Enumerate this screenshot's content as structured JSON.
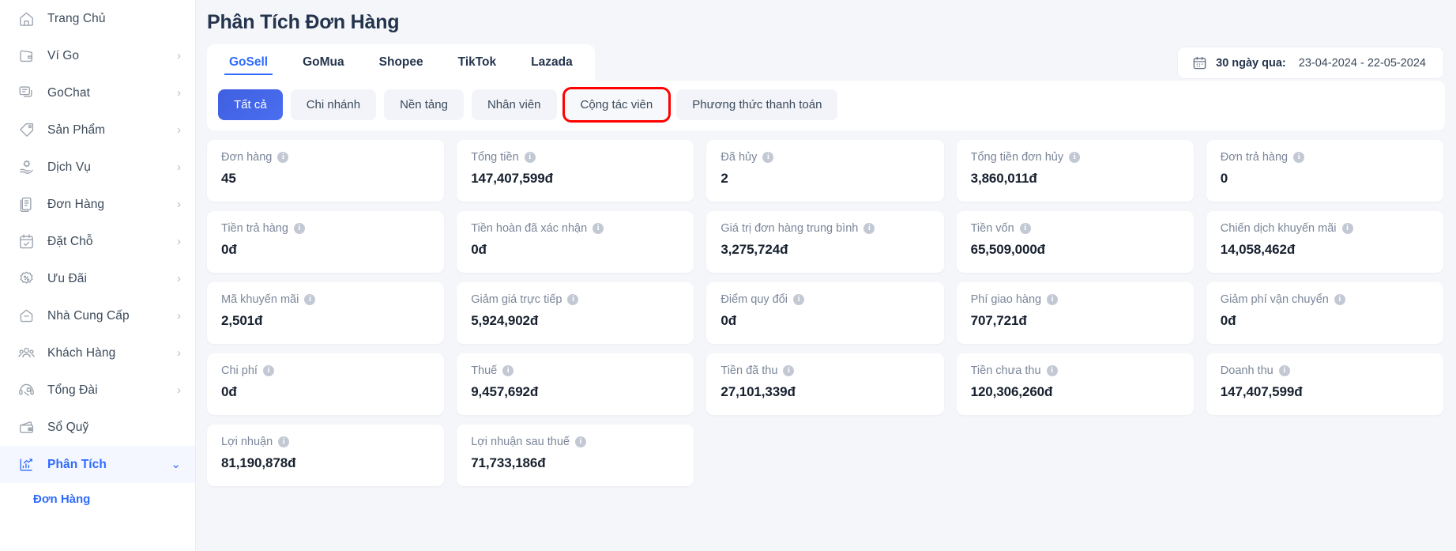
{
  "sidebar": {
    "items": [
      {
        "label": "Trang Chủ",
        "icon": "home-icon",
        "chevron": "",
        "active": false
      },
      {
        "label": "Ví Go",
        "icon": "wallet-icon",
        "chevron": "›",
        "active": false
      },
      {
        "label": "GoChat",
        "icon": "chat-icon",
        "chevron": "›",
        "active": false
      },
      {
        "label": "Sản Phẩm",
        "icon": "tag-icon",
        "chevron": "›",
        "active": false
      },
      {
        "label": "Dịch Vụ",
        "icon": "service-hand-icon",
        "chevron": "›",
        "active": false
      },
      {
        "label": "Đơn Hàng",
        "icon": "orders-document-icon",
        "chevron": "›",
        "active": false
      },
      {
        "label": "Đặt Chỗ",
        "icon": "calendar-check-icon",
        "chevron": "›",
        "active": false
      },
      {
        "label": "Ưu Đãi",
        "icon": "discount-percent-icon",
        "chevron": "›",
        "active": false
      },
      {
        "label": "Nhà Cung Cấp",
        "icon": "supplier-icon",
        "chevron": "›",
        "active": false
      },
      {
        "label": "Khách Hàng",
        "icon": "customers-icon",
        "chevron": "›",
        "active": false
      },
      {
        "label": "Tổng Đài",
        "icon": "call-center-icon",
        "chevron": "›",
        "active": false
      },
      {
        "label": "Sổ Quỹ",
        "icon": "cash-book-icon",
        "chevron": "",
        "active": false
      },
      {
        "label": "Phân Tích",
        "icon": "analytics-chart-icon",
        "chevron": "⌄",
        "active": true
      }
    ],
    "subitem": {
      "label": "Đơn Hàng"
    }
  },
  "header": {
    "title": "Phân Tích Đơn Hàng"
  },
  "tabs": [
    {
      "label": "GoSell",
      "active": true
    },
    {
      "label": "GoMua",
      "active": false
    },
    {
      "label": "Shopee",
      "active": false
    },
    {
      "label": "TikTok",
      "active": false
    },
    {
      "label": "Lazada",
      "active": false
    }
  ],
  "daterange": {
    "icon": "calendar-icon",
    "label": "30 ngày qua:",
    "value": "23-04-2024 - 22-05-2024"
  },
  "filters": [
    {
      "label": "Tất cả",
      "state": "active"
    },
    {
      "label": "Chi nhánh",
      "state": "normal"
    },
    {
      "label": "Nền tảng",
      "state": "normal"
    },
    {
      "label": "Nhân viên",
      "state": "normal"
    },
    {
      "label": "Cộng tác viên",
      "state": "highlight"
    },
    {
      "label": "Phương thức thanh toán",
      "state": "normal"
    }
  ],
  "metrics": [
    {
      "label": "Đơn hàng",
      "value": "45"
    },
    {
      "label": "Tổng tiền",
      "value": "147,407,599đ"
    },
    {
      "label": "Đã hủy",
      "value": "2"
    },
    {
      "label": "Tổng tiền đơn hủy",
      "value": "3,860,011đ"
    },
    {
      "label": "Đơn trả hàng",
      "value": "0"
    },
    {
      "label": "Tiền trả hàng",
      "value": "0đ"
    },
    {
      "label": "Tiền hoàn đã xác nhận",
      "value": "0đ"
    },
    {
      "label": "Giá trị đơn hàng trung bình",
      "value": "3,275,724đ"
    },
    {
      "label": "Tiền vốn",
      "value": "65,509,000đ"
    },
    {
      "label": "Chiến dịch khuyến mãi",
      "value": "14,058,462đ"
    },
    {
      "label": "Mã khuyến mãi",
      "value": "2,501đ"
    },
    {
      "label": "Giảm giá trực tiếp",
      "value": "5,924,902đ"
    },
    {
      "label": "Điểm quy đổi",
      "value": "0đ"
    },
    {
      "label": "Phí giao hàng",
      "value": "707,721đ"
    },
    {
      "label": "Giảm phí vận chuyển",
      "value": "0đ"
    },
    {
      "label": "Chi phí",
      "value": "0đ"
    },
    {
      "label": "Thuế",
      "value": "9,457,692đ"
    },
    {
      "label": "Tiền đã thu",
      "value": "27,101,339đ"
    },
    {
      "label": "Tiền chưa thu",
      "value": "120,306,260đ"
    },
    {
      "label": "Doanh thu",
      "value": "147,407,599đ"
    },
    {
      "label": "Lợi nhuận",
      "value": "81,190,878đ"
    },
    {
      "label": "Lợi nhuận sau thuế",
      "value": "71,733,186đ"
    }
  ],
  "info_icon_glyph": "i",
  "colors": {
    "accent": "#2f6bff",
    "active_pill": "#4a6ef0",
    "highlight_border": "#ff0000",
    "page_bg": "#f4f6f9",
    "card_bg": "#ffffff",
    "title": "#24344d",
    "muted": "#7b8699"
  }
}
